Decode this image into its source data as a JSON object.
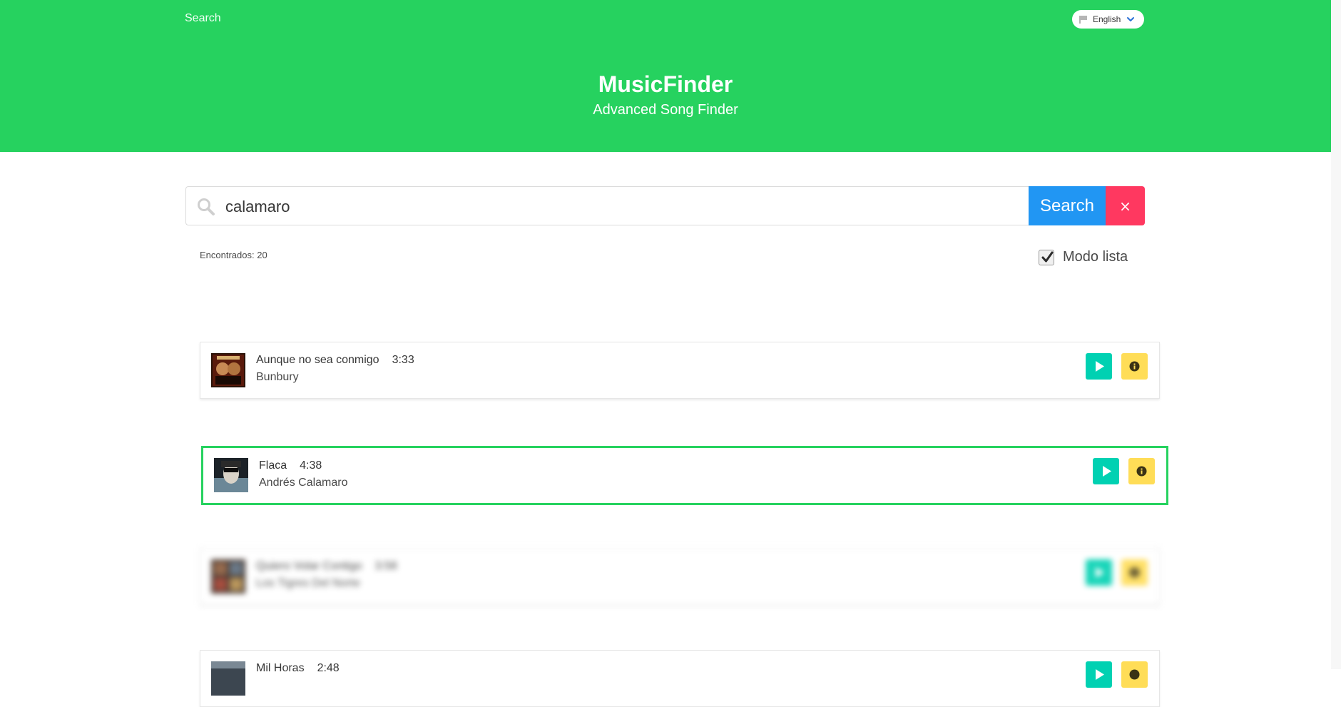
{
  "nav": {
    "search_link": "Search",
    "language": "English"
  },
  "hero": {
    "title": "MusicFinder",
    "subtitle": "Advanced Song Finder"
  },
  "search": {
    "value": "calamaro",
    "button_label": "Search",
    "clear_label": "×"
  },
  "results": {
    "found_label": "Encontrados: 20",
    "list_mode_label": "Modo lista",
    "list_mode_checked": true
  },
  "tracks": [
    {
      "title": "Aunque no sea conmigo",
      "duration": "3:33",
      "artist": "Bunbury",
      "state": "normal"
    },
    {
      "title": "Flaca",
      "duration": "4:38",
      "artist": "Andrés Calamaro",
      "state": "active"
    },
    {
      "title": "Quiero Volar Contigo",
      "duration": "3:58",
      "artist": "Los Tigres Del Norte",
      "state": "blurred"
    },
    {
      "title": "Mil Horas",
      "duration": "2:48",
      "artist": "",
      "state": "normal"
    }
  ],
  "colors": {
    "brand_green": "#26d25f",
    "search_blue": "#2196f3",
    "clear_red": "#ff3860",
    "play_teal": "#00d1b2",
    "info_yellow": "#ffdd57"
  },
  "icons": {
    "search": "search-icon",
    "flag": "flag-icon",
    "chevron": "chevron-down-icon",
    "play": "play-icon",
    "info": "info-icon",
    "check": "check-icon"
  }
}
